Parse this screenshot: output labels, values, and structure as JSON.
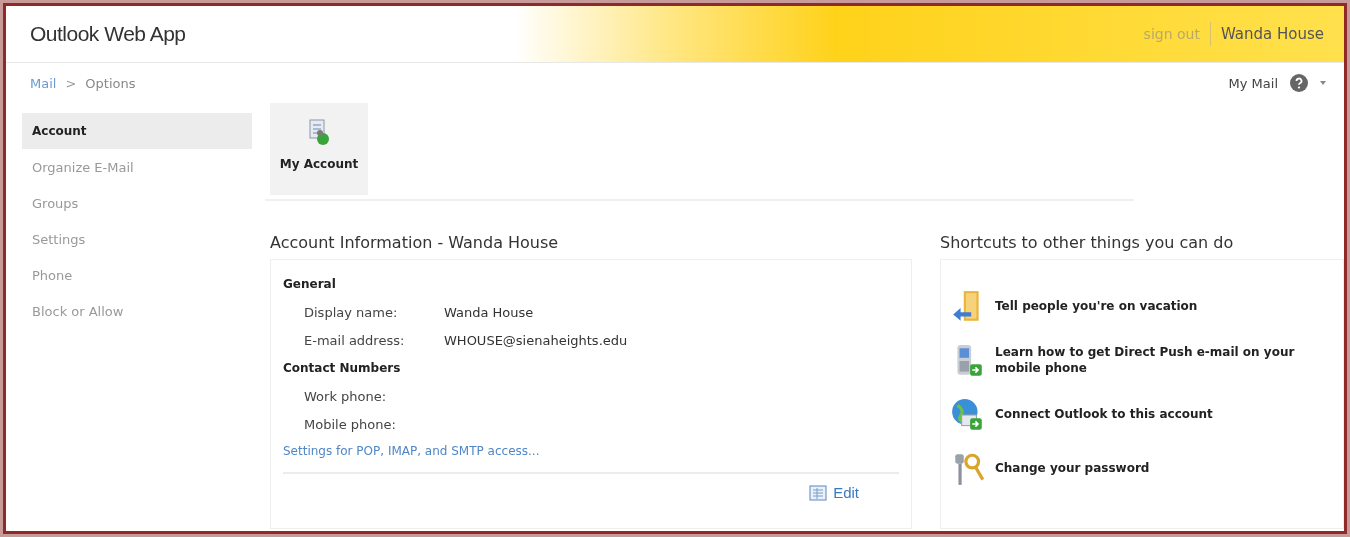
{
  "header": {
    "product": "Outlook Web App",
    "sign_out": "sign out",
    "user": "Wanda House"
  },
  "breadcrumb": {
    "items": [
      "Mail",
      "Options"
    ],
    "separator": ">"
  },
  "toolbar": {
    "my_mail": "My Mail"
  },
  "sidebar": {
    "items": [
      {
        "label": "Account",
        "selected": true
      },
      {
        "label": "Organize E-Mail",
        "selected": false
      },
      {
        "label": "Groups",
        "selected": false
      },
      {
        "label": "Settings",
        "selected": false
      },
      {
        "label": "Phone",
        "selected": false
      },
      {
        "label": "Block or Allow",
        "selected": false
      }
    ]
  },
  "tabs": [
    {
      "label": "My Account",
      "selected": true
    }
  ],
  "account": {
    "title": "Account Information - Wanda House",
    "sections": [
      {
        "heading": "General",
        "fields": [
          {
            "label": "Display name:",
            "value": "Wanda House"
          },
          {
            "label": "E-mail address:",
            "value": "WHOUSE@sienaheights.edu"
          }
        ]
      },
      {
        "heading": "Contact Numbers",
        "fields": [
          {
            "label": "Work phone:"
          },
          {
            "label": "Mobile phone:"
          }
        ]
      }
    ],
    "link": "Settings for POP, IMAP, and SMTP access...",
    "edit": "Edit"
  },
  "shortcuts": {
    "title": "Shortcuts to other things you can do",
    "items": [
      {
        "kind": "vacation",
        "label": "Tell people you're on vacation"
      },
      {
        "kind": "phone",
        "label": "Learn how to get Direct Push e-mail on your mobile phone"
      },
      {
        "kind": "globe",
        "label": "Connect Outlook to this account"
      },
      {
        "kind": "keys",
        "label": "Change your password"
      }
    ]
  }
}
